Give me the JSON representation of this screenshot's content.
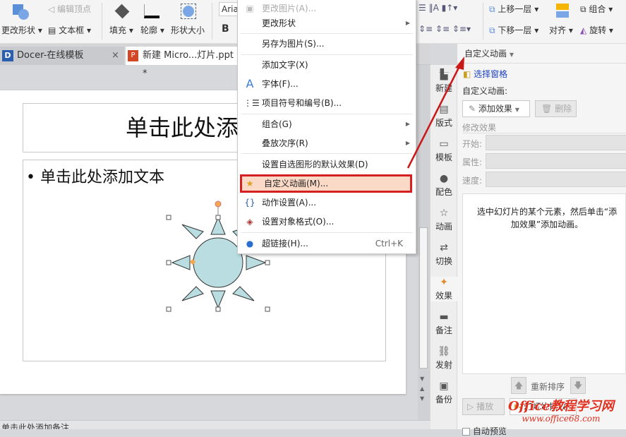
{
  "ribbon": {
    "change_shape": "更改形状",
    "edit_vertices": "编辑顶点",
    "text_box": "文本框",
    "fill": "填充",
    "outline": "轮廓",
    "shape_size": "形状大小",
    "font_name": "Aria",
    "bold": "B",
    "bring_forward": "上移一层",
    "send_backward": "下移一层",
    "group": "组合",
    "align": "对齐",
    "rotate": "旋转"
  },
  "tabs": [
    {
      "label": "Docer-在线模板",
      "close": "×"
    },
    {
      "label": "新建 Micro...灯片.ppt *"
    }
  ],
  "slide": {
    "title_placeholder": "单击此处添加标",
    "body_placeholder": "单击此处添加文本",
    "bullet": "•"
  },
  "context_menu": [
    {
      "label": "更改图片(A)...",
      "disabled": true
    },
    {
      "label": "更改形状",
      "submenu": true
    },
    {
      "label": "另存为图片(S)..."
    },
    {
      "label": "添加文字(X)"
    },
    {
      "label": "字体(F)..."
    },
    {
      "label": "项目符号和编号(B)..."
    },
    {
      "label": "组合(G)",
      "submenu": true
    },
    {
      "label": "叠放次序(R)",
      "submenu": true
    },
    {
      "label": "设置自选图形的默认效果(D)"
    },
    {
      "label": "自定义动画(M)...",
      "highlighted": true
    },
    {
      "label": "动作设置(A)..."
    },
    {
      "label": "设置对象格式(O)..."
    },
    {
      "label": "超链接(H)...",
      "shortcut": "Ctrl+K"
    }
  ],
  "side_strip": [
    "新建",
    "版式",
    "模板",
    "配色",
    "动画",
    "切换",
    "效果",
    "备注",
    "发射",
    "备份"
  ],
  "panel": {
    "title": "自定义动画",
    "select_pane": "选择窗格",
    "section_label": "自定义动画:",
    "add_effect": "添加效果",
    "delete": "删除",
    "modify_effect": "修改效果",
    "start": "开始:",
    "property": "属性:",
    "speed": "速度:",
    "hint": "选中幻灯片的某个元素，然后单击“添加效果”添加动画。",
    "reorder": "重新排序",
    "play": "播放",
    "slideshow": "幻灯片播放",
    "auto_preview": "自动预览"
  },
  "notes_placeholder": "单击此处添加备注",
  "watermark": {
    "line1": "Office教程学习网",
    "line2": "www.office68.com"
  },
  "colors": {
    "highlight_border": "#d42020",
    "highlight_bg": "#fbd9c7",
    "sun_fill": "#b9dde0",
    "link": "#1a3fbf"
  }
}
